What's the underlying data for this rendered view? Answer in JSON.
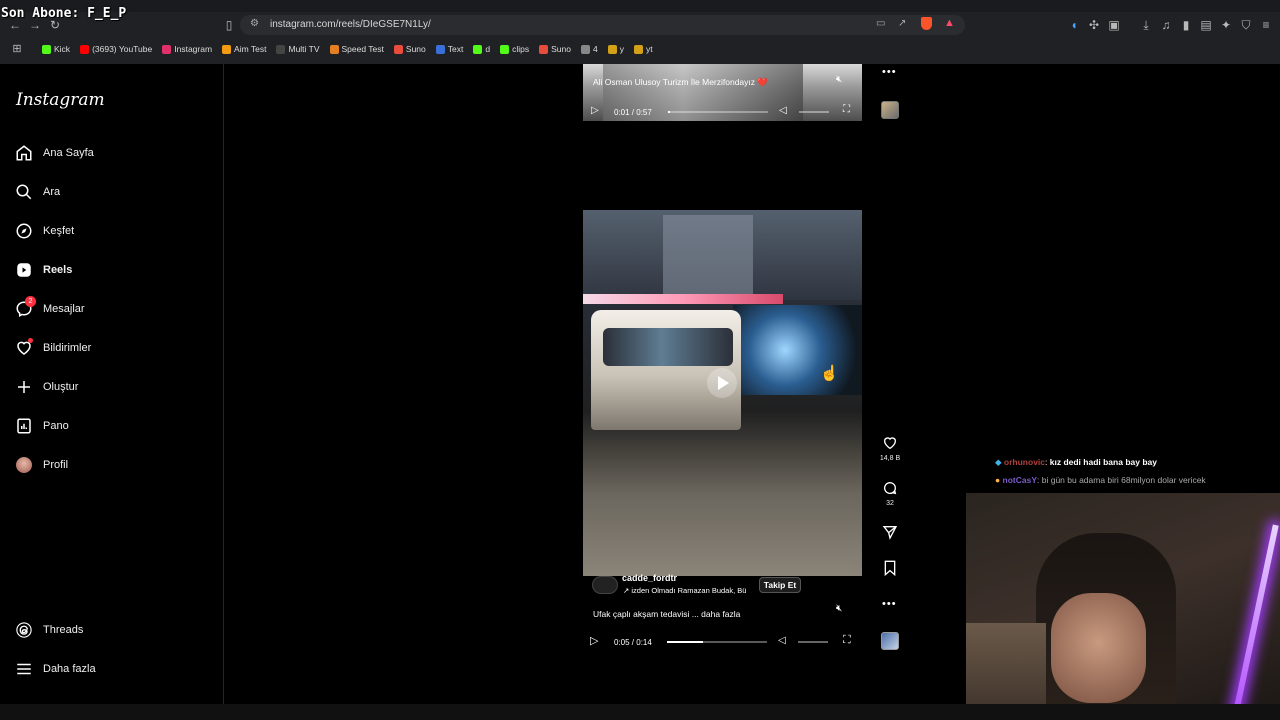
{
  "overlay": {
    "streamer_text": "Son Abone: F_E_P"
  },
  "browser": {
    "url": "instagram.com/reels/DIeGSE7N1Ly/",
    "bookmarks": [
      {
        "label": "Kick",
        "color": "#53fc18"
      },
      {
        "label": "(3693) YouTube",
        "color": "#ff0000"
      },
      {
        "label": "Instagram",
        "color": "#e1306c"
      },
      {
        "label": "Aim Test",
        "color": "#f39c12"
      },
      {
        "label": "Multi TV",
        "color": "#444444"
      },
      {
        "label": "Speed Test",
        "color": "#e67e22"
      },
      {
        "label": "Suno",
        "color": "#e74c3c"
      },
      {
        "label": "Text",
        "color": "#3b6fd8"
      },
      {
        "label": "d",
        "color": "#53fc18"
      },
      {
        "label": "clips",
        "color": "#53fc18"
      },
      {
        "label": "Suno",
        "color": "#e74c3c"
      },
      {
        "label": "4",
        "color": "#888888"
      },
      {
        "label": "y",
        "color": "#d4a017"
      },
      {
        "label": "yt",
        "color": "#d4a017"
      }
    ]
  },
  "sidebar": {
    "logo": "Instagram",
    "items": [
      {
        "label": "Ana Sayfa",
        "icon": "home-icon"
      },
      {
        "label": "Ara",
        "icon": "search-icon"
      },
      {
        "label": "Keşfet",
        "icon": "compass-icon"
      },
      {
        "label": "Reels",
        "icon": "reels-icon"
      },
      {
        "label": "Mesajlar",
        "icon": "messenger-icon",
        "badge": "2"
      },
      {
        "label": "Bildirimler",
        "icon": "heart-icon"
      },
      {
        "label": "Oluştur",
        "icon": "plus-icon"
      },
      {
        "label": "Pano",
        "icon": "dashboard-icon"
      },
      {
        "label": "Profil",
        "icon": "avatar-icon"
      }
    ],
    "bottom_items": [
      {
        "label": "Threads",
        "icon": "threads-icon"
      },
      {
        "label": "Daha fazla",
        "icon": "menu-icon"
      }
    ]
  },
  "reel1": {
    "caption": "Ali Osman Ulusoy Turizm İle Merzifondayız ❤️",
    "time": "0:01 / 0:57",
    "progress": 0.02
  },
  "reel2": {
    "username": "cadde_fordtr",
    "follow_label": "Takip Et",
    "audio": "izden Olmadı  Ramazan Budak, Bü",
    "caption": "Ufak çaplı akşam tedavisi ... daha fazla",
    "time": "0:05 / 0:14",
    "progress": 0.36,
    "likes": "14,8 B",
    "comments": "32"
  },
  "chat": [
    {
      "user": "orhunovic",
      "message": "kız dedi hadi bana bay bay",
      "user_color": "#b0413e"
    },
    {
      "user": "notCasY",
      "message": "bi gün bu adama biri 68milyon dolar vericek",
      "user_color": "#7a5dc7"
    }
  ]
}
